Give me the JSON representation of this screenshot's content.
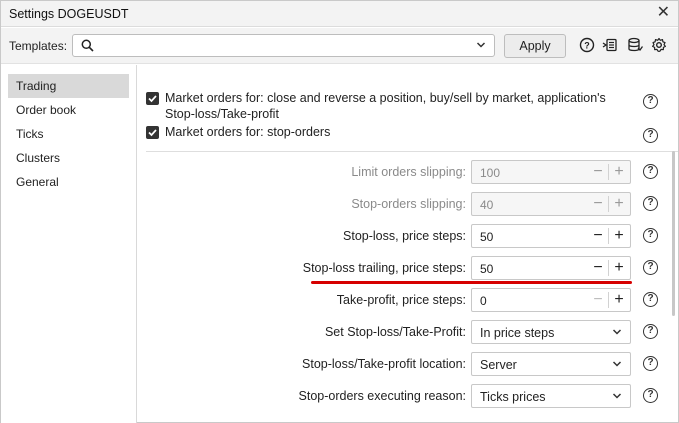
{
  "window": {
    "title": "Settings DOGEUSDT"
  },
  "toolbar": {
    "templates_label": "Templates:",
    "search_placeholder": "",
    "apply_label": "Apply",
    "icons": [
      "help-icon",
      "import-icon",
      "database-icon",
      "gear-icon"
    ]
  },
  "sidebar": {
    "items": [
      {
        "label": "Trading",
        "active": true
      },
      {
        "label": "Order book"
      },
      {
        "label": "Ticks"
      },
      {
        "label": "Clusters"
      },
      {
        "label": "General"
      }
    ]
  },
  "trading": {
    "checkboxes": [
      {
        "label": "Market orders for: close and reverse a position, buy/sell by market, application's Stop-loss/Take-profit",
        "checked": true
      },
      {
        "label": "Market orders for: stop-orders",
        "checked": true
      }
    ],
    "rows": [
      {
        "label": "Limit orders slipping:",
        "value": "100",
        "enabled": false
      },
      {
        "label": "Stop-orders slipping:",
        "value": "40",
        "enabled": false
      },
      {
        "label": "Stop-loss, price steps:",
        "value": "50",
        "enabled": true
      },
      {
        "label": "Stop-loss trailing, price steps:",
        "value": "50",
        "enabled": true,
        "highlighted": true
      },
      {
        "label": "Take-profit, price steps:",
        "value": "0",
        "enabled": true
      },
      {
        "label": "Set Stop-loss/Take-Profit:",
        "value": "In price steps",
        "type": "select"
      },
      {
        "label": "Stop-loss/Take-profit location:",
        "value": "Server",
        "type": "select"
      },
      {
        "label": "Stop-orders executing reason:",
        "value": "Ticks prices",
        "type": "select"
      }
    ],
    "help_glyph": "?"
  },
  "colors": {
    "highlight_underline": "#d60000",
    "active_tab_bg": "#d9d9d9"
  }
}
